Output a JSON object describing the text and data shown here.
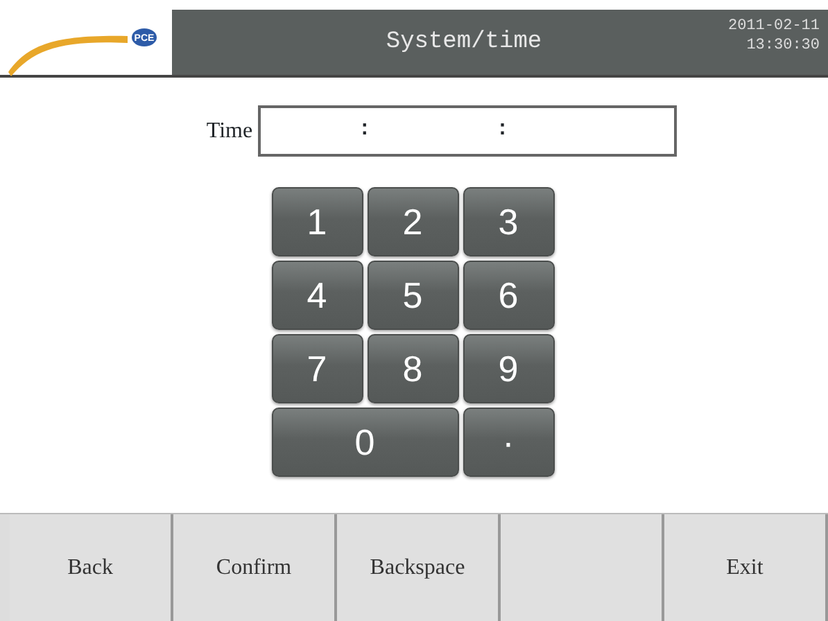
{
  "header": {
    "logo_text": "PCE",
    "title": "System/time",
    "date": "2011-02-11",
    "time": "13:30:30"
  },
  "time_field": {
    "label": "Time",
    "separators": [
      ":",
      ":"
    ]
  },
  "keypad": [
    {
      "label": "1",
      "kind": "normal"
    },
    {
      "label": "2",
      "kind": "normal"
    },
    {
      "label": "3",
      "kind": "normal"
    },
    {
      "label": "4",
      "kind": "normal"
    },
    {
      "label": "5",
      "kind": "normal"
    },
    {
      "label": "6",
      "kind": "normal"
    },
    {
      "label": "7",
      "kind": "normal"
    },
    {
      "label": "8",
      "kind": "normal"
    },
    {
      "label": "9",
      "kind": "normal"
    },
    {
      "label": "0",
      "kind": "wide"
    },
    {
      "label": "·",
      "kind": "normal"
    }
  ],
  "buttons": [
    {
      "label": "Back",
      "kind": "text"
    },
    {
      "label": "Confirm",
      "kind": "text"
    },
    {
      "label": "Backspace",
      "kind": "text"
    },
    {
      "kind": "blank"
    },
    {
      "label": "Exit",
      "kind": "text"
    }
  ]
}
